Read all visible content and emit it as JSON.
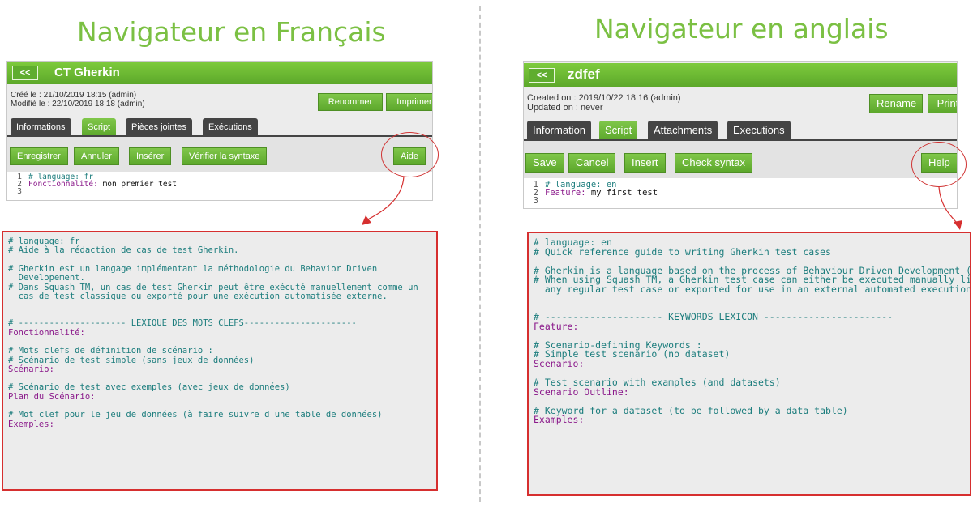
{
  "headings": {
    "fr": "Navigateur en Français",
    "en": "Navigateur en anglais"
  },
  "fr": {
    "back_label": "<<",
    "title": "CT Gherkin",
    "created": "Créé le :  21/10/2019 18:15 (admin)",
    "modified": "Modifié le :  22/10/2019 18:18 (admin)",
    "rename_label": "Renommer",
    "print_label": "Imprimer",
    "tabs": [
      "Informations",
      "Script",
      "Pièces jointes",
      "Exécutions"
    ],
    "active_tab": "Script",
    "toolbar": {
      "save": "Enregistrer",
      "cancel": "Annuler",
      "insert": "Insérer",
      "check": "Vérifier la syntaxe",
      "help": "Aide"
    },
    "editor_lines": [
      {
        "num": "1",
        "comment": "# language: fr",
        "keyword": "",
        "text": ""
      },
      {
        "num": "2",
        "comment": "",
        "keyword": "Fonctionnalité:",
        "text": " mon premier test"
      },
      {
        "num": "3",
        "comment": "",
        "keyword": "",
        "text": ""
      }
    ],
    "help_lines": [
      {
        "t": "cm",
        "v": "# language: fr"
      },
      {
        "t": "cm",
        "v": "# Aide à la rédaction de cas de test Gherkin."
      },
      {
        "t": "blank",
        "v": ""
      },
      {
        "t": "cm",
        "v": "# Gherkin est un langage implémentant la méthodologie du Behavior Driven"
      },
      {
        "t": "cm",
        "v": "  Developement."
      },
      {
        "t": "cm",
        "v": "# Dans Squash TM, un cas de test Gherkin peut être exécuté manuellement comme un"
      },
      {
        "t": "cm",
        "v": "  cas de test classique ou exporté pour une exécution automatisée externe."
      },
      {
        "t": "blank",
        "v": ""
      },
      {
        "t": "blank",
        "v": ""
      },
      {
        "t": "cm",
        "v": "# --------------------- LEXIQUE DES MOTS CLEFS----------------------"
      },
      {
        "t": "kw",
        "v": "Fonctionnalité:"
      },
      {
        "t": "blank",
        "v": ""
      },
      {
        "t": "cm",
        "v": "# Mots clefs de définition de scénario :"
      },
      {
        "t": "cm",
        "v": "# Scénario de test simple (sans jeux de données)"
      },
      {
        "t": "kw",
        "v": "Scénario:"
      },
      {
        "t": "blank",
        "v": ""
      },
      {
        "t": "cm",
        "v": "# Scénario de test avec exemples (avec jeux de données)"
      },
      {
        "t": "kw",
        "v": "Plan du Scénario:"
      },
      {
        "t": "blank",
        "v": ""
      },
      {
        "t": "cm",
        "v": "# Mot clef pour le jeu de données (à faire suivre d'une table de données)"
      },
      {
        "t": "kw",
        "v": "Exemples:"
      }
    ]
  },
  "en": {
    "back_label": "<<",
    "title": "zdfef",
    "created": "Created on :  2019/10/22 18:16 (admin)",
    "modified": "Updated on :  never",
    "rename_label": "Rename",
    "print_label": "Print",
    "tabs": [
      "Information",
      "Script",
      "Attachments",
      "Executions"
    ],
    "active_tab": "Script",
    "toolbar": {
      "save": "Save",
      "cancel": "Cancel",
      "insert": "Insert",
      "check": "Check syntax",
      "help": "Help"
    },
    "editor_lines": [
      {
        "num": "1",
        "comment": "# language: en",
        "keyword": "",
        "text": ""
      },
      {
        "num": "2",
        "comment": "",
        "keyword": "Feature:",
        "text": " my first test"
      },
      {
        "num": "3",
        "comment": "",
        "keyword": "",
        "text": ""
      }
    ],
    "help_lines": [
      {
        "t": "cm",
        "v": "# language: en"
      },
      {
        "t": "cm",
        "v": "# Quick reference guide to writing Gherkin test cases"
      },
      {
        "t": "blank",
        "v": ""
      },
      {
        "t": "cm",
        "v": "# Gherkin is a language based on the process of Behaviour Driven Development (BDD)."
      },
      {
        "t": "cm",
        "v": "# When using Squash TM, a Gherkin test case can either be executed manually like"
      },
      {
        "t": "cm",
        "v": "  any regular test case or exported for use in an external automated execution."
      },
      {
        "t": "blank",
        "v": ""
      },
      {
        "t": "blank",
        "v": ""
      },
      {
        "t": "cm",
        "v": "# --------------------- KEYWORDS LEXICON -----------------------"
      },
      {
        "t": "kw",
        "v": "Feature:"
      },
      {
        "t": "blank",
        "v": ""
      },
      {
        "t": "cm",
        "v": "# Scenario-defining Keywords :"
      },
      {
        "t": "cm",
        "v": "# Simple test scenario (no dataset)"
      },
      {
        "t": "kw",
        "v": "Scenario:"
      },
      {
        "t": "blank",
        "v": ""
      },
      {
        "t": "cm",
        "v": "# Test scenario with examples (and datasets)"
      },
      {
        "t": "kw",
        "v": "Scenario Outline:"
      },
      {
        "t": "blank",
        "v": ""
      },
      {
        "t": "cm",
        "v": "# Keyword for a dataset (to be followed by a data table)"
      },
      {
        "t": "kw",
        "v": "Examples:"
      }
    ]
  },
  "colors": {
    "heading": "#7bc043",
    "button_green": "#6cb83a",
    "annotation_red": "#d62f2f",
    "comment": "#1c7d7d",
    "keyword": "#8b1a8b"
  }
}
